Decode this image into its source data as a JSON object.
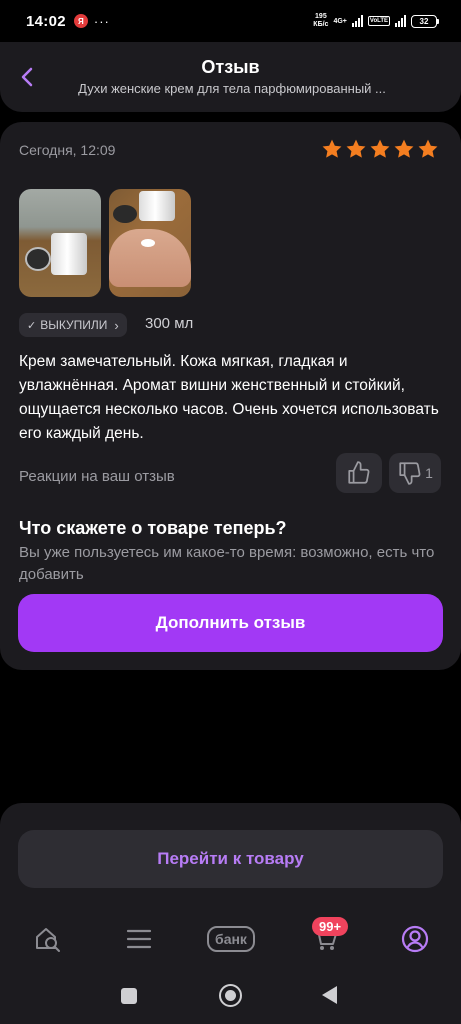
{
  "status_bar": {
    "time": "14:02",
    "app_icon_label": "Я",
    "dots": "···",
    "speed_value": "195",
    "speed_unit": "КБ/с",
    "network": "4G+",
    "volte": "VoLTE",
    "battery": "32"
  },
  "header": {
    "title": "Отзыв",
    "subtitle": "Духи женские крем для тела парфюмированный ..."
  },
  "review": {
    "date": "Сегодня, 12:09",
    "rating": 5,
    "rating_max": 5,
    "star_color": "#f47e20",
    "bought_label": "ВЫКУПИЛИ",
    "bought_check": "✓",
    "bought_chevron": "›",
    "volume": "300 мл",
    "text": "Крем замечательный. Кожа мягкая, гладкая и увлажнённая. Аромат вишни женственный и стойкий, ощущается несколько часов. Очень хочется использовать его каждый день.",
    "reactions_label": "Реакции на ваш отзыв",
    "dislike_count": "1"
  },
  "prompt": {
    "title": "Что скажете о товаре теперь?",
    "text": "Вы уже пользуетесь им какое-то время: возможно, есть что добавить",
    "button_label": "Дополнить отзыв"
  },
  "bottom": {
    "goto_label": "Перейти к товару",
    "bank_label": "банк",
    "cart_badge": "99+"
  },
  "colors": {
    "accent": "#a239f5",
    "accent_text": "#b77cf5",
    "badge": "#f0435d",
    "card": "#1c1b1f"
  }
}
